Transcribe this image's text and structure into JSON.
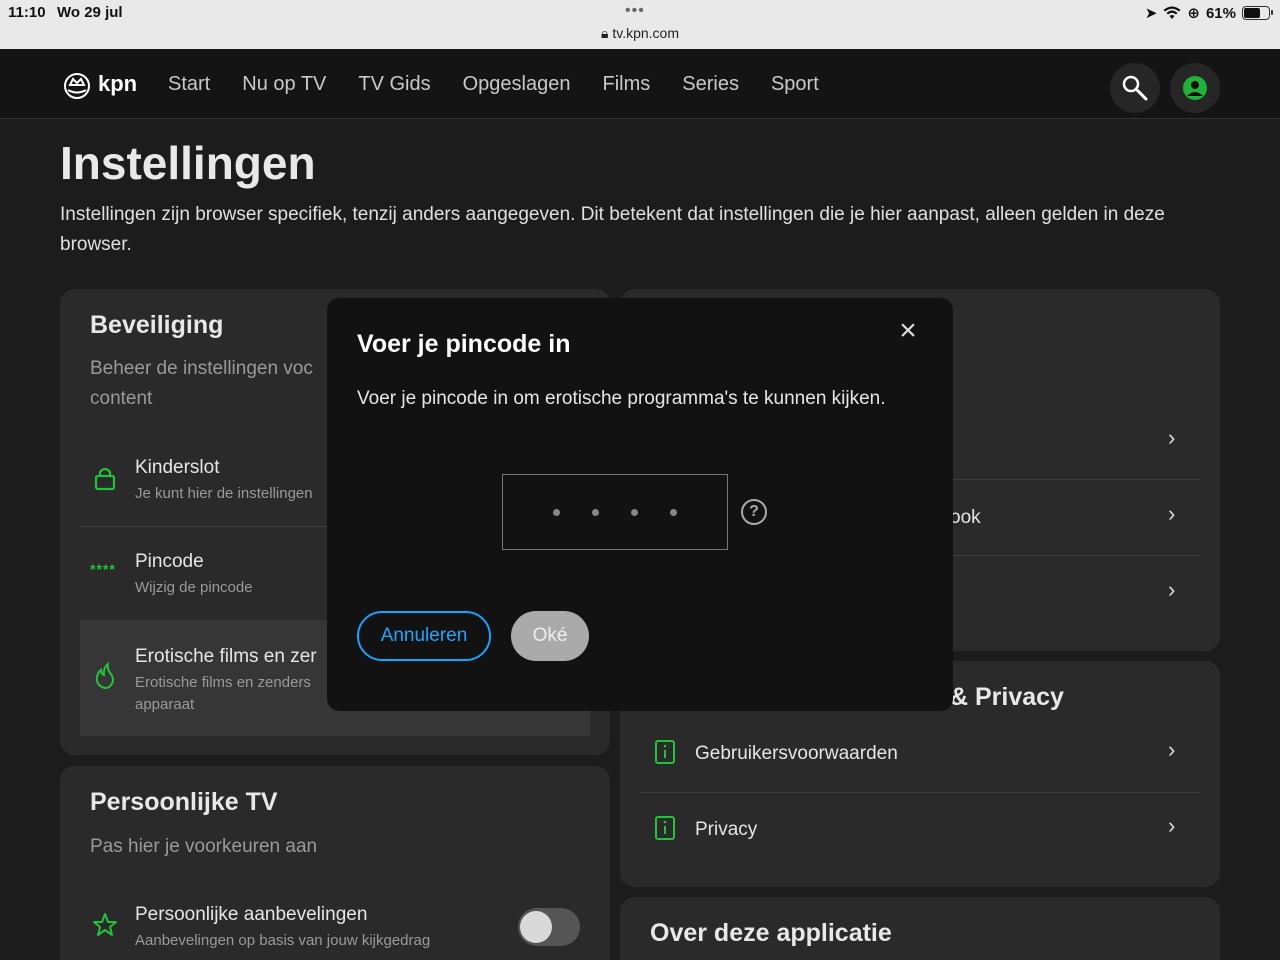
{
  "status_bar": {
    "time": "11:10",
    "date": "Wo 29 jul",
    "url": "tv.kpn.com",
    "battery": "61%"
  },
  "nav": {
    "logo": "kpn",
    "items": [
      "Start",
      "Nu op TV",
      "TV Gids",
      "Opgeslagen",
      "Films",
      "Series",
      "Sport"
    ]
  },
  "page": {
    "title": "Instellingen",
    "intro": "Instellingen zijn browser specifiek, tenzij anders aangegeven. Dit betekent dat instellingen die je hier aanpast, alleen gelden in deze browser."
  },
  "security": {
    "title": "Beveiliging",
    "subtitle": "Beheer de instellingen voc\ncontent",
    "kinderslot_title": "Kinderslot",
    "kinderslot_sub": "Je kunt hier de instellingen",
    "pincode_title": "Pincode",
    "pincode_sub": "Wijzig de pincode",
    "pincode_glyph": "****",
    "erotic_title": "Erotische films en zer",
    "erotic_sub": "Erotische films en zenders\napparaat"
  },
  "right_card": {
    "row2_fragment": "ook"
  },
  "privacy": {
    "title_fragment": "& Privacy",
    "terms": "Gebruikersvoorwaarden",
    "privacy": "Privacy"
  },
  "personal": {
    "title": "Persoonlijke TV",
    "subtitle": "Pas hier je voorkeuren aan",
    "rec_title": "Persoonlijke aanbevelingen",
    "rec_sub": "Aanbevelingen op basis van jouw kijkgedrag"
  },
  "about": {
    "title": "Over deze applicatie"
  },
  "modal": {
    "title": "Voer je pincode in",
    "message": "Voer je pincode in om erotische programma's te kunnen kijken.",
    "cancel": "Annuleren",
    "ok": "Oké",
    "close": "×",
    "help": "?"
  },
  "colors": {
    "accent_green": "#22c33a",
    "link_blue": "#1aa7ff",
    "bg": "#1c1c1c",
    "card": "#2a2a2a"
  }
}
